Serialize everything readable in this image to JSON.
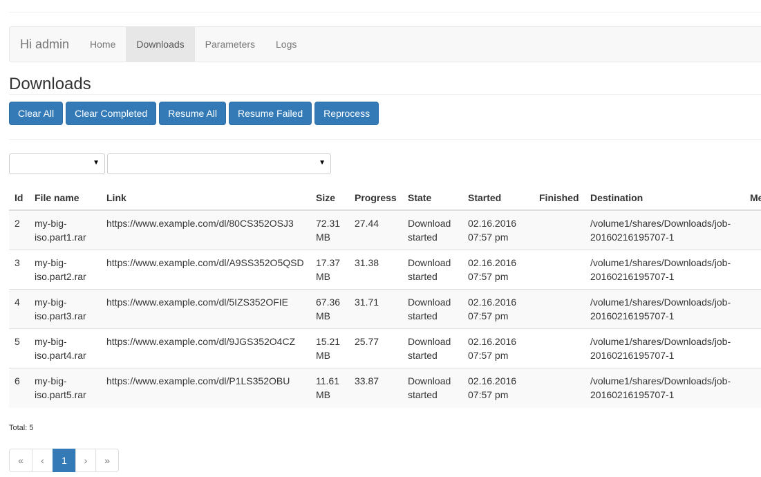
{
  "nav": {
    "brand": "Hi admin",
    "items": [
      {
        "label": "Home"
      },
      {
        "label": "Downloads",
        "active": true
      },
      {
        "label": "Parameters"
      },
      {
        "label": "Logs"
      }
    ]
  },
  "page_title": "Downloads",
  "buttons": [
    "Clear All",
    "Clear Completed",
    "Resume All",
    "Resume Failed",
    "Reprocess"
  ],
  "filters": [
    {
      "value": ""
    },
    {
      "value": ""
    }
  ],
  "table": {
    "headers": [
      "Id",
      "File name",
      "Link",
      "Size",
      "Progress",
      "State",
      "Started",
      "Finished",
      "Destination",
      "Me"
    ],
    "rows": [
      [
        "2",
        "my-big-iso.part1.rar",
        "https://www.example.com/dl/80CS352OSJ3",
        "72.31 MB",
        "27.44",
        "Download started",
        "02.16.2016 07:57 pm",
        "",
        "/volume1/shares/Downloads/job-20160216195707-1",
        ""
      ],
      [
        "3",
        "my-big-iso.part2.rar",
        "https://www.example.com/dl/A9SS352O5QSD",
        "17.37 MB",
        "31.38",
        "Download started",
        "02.16.2016 07:57 pm",
        "",
        "/volume1/shares/Downloads/job-20160216195707-1",
        ""
      ],
      [
        "4",
        "my-big-iso.part3.rar",
        "https://www.example.com/dl/5IZS352OFIE",
        "67.36 MB",
        "31.71",
        "Download started",
        "02.16.2016 07:57 pm",
        "",
        "/volume1/shares/Downloads/job-20160216195707-1",
        ""
      ],
      [
        "5",
        "my-big-iso.part4.rar",
        "https://www.example.com/dl/9JGS352O4CZ",
        "15.21 MB",
        "25.77",
        "Download started",
        "02.16.2016 07:57 pm",
        "",
        "/volume1/shares/Downloads/job-20160216195707-1",
        ""
      ],
      [
        "6",
        "my-big-iso.part5.rar",
        "https://www.example.com/dl/P1LS352OBU",
        "11.61 MB",
        "33.87",
        "Download started",
        "02.16.2016 07:57 pm",
        "",
        "/volume1/shares/Downloads/job-20160216195707-1",
        ""
      ]
    ]
  },
  "total": "Total: 5",
  "pagination": {
    "first": "«",
    "prev": "‹",
    "pages": [
      "1"
    ],
    "current": "1",
    "next": "›",
    "last": "»"
  },
  "colors": {
    "primary": "#337ab7"
  }
}
